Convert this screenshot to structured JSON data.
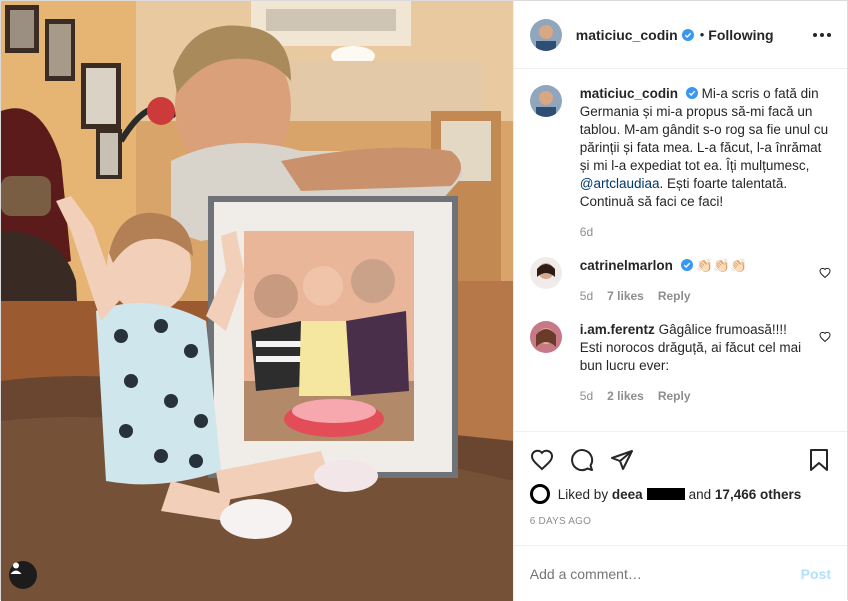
{
  "post": {
    "username": "maticiuc_codin",
    "follow_state": "Following",
    "separator": "•"
  },
  "caption": {
    "username": "maticiuc_codin",
    "text_before_mention": "Mi-a scris o fată din Germania și mi-a propus să-mi facă un tablou. M-am gândit s-o rog sa fie unul cu părinții și fata mea. L-a făcut, l-a înrămat și mi l-a expediat tot ea. Îți mulțumesc, ",
    "mention": "@artclaudiaa",
    "text_after_mention": ". Ești foarte talentată. Continuă să faci ce faci!",
    "age": "6d"
  },
  "comments": [
    {
      "username": "catrinelmarlon",
      "verified": true,
      "text": "👏🏻👏🏻👏🏻",
      "age": "5d",
      "likes": "7 likes",
      "reply": "Reply"
    },
    {
      "username": "i.am.ferentz",
      "verified": false,
      "text": "Gâgâlice frumoasă!!!! Esti norocos drăguță, ai făcut cel mai bun lucru ever:",
      "age": "5d",
      "likes": "2 likes",
      "reply": "Reply"
    }
  ],
  "likes": {
    "prefix": "Liked by",
    "first_liker": "deea",
    "conjunction": "and",
    "others": "17,466 others"
  },
  "timestamp": "6 DAYS AGO",
  "add_comment": {
    "placeholder": "Add a comment…",
    "post_label": "Post"
  },
  "colors": {
    "verified": "#3897f0",
    "mention": "#00376b",
    "muted": "#8e8e8e",
    "post_disabled": "#b2dffc"
  },
  "icons": [
    "verified-badge-icon",
    "more-options-icon",
    "heart-icon",
    "comment-icon",
    "share-icon",
    "bookmark-icon",
    "user-tag-icon"
  ]
}
